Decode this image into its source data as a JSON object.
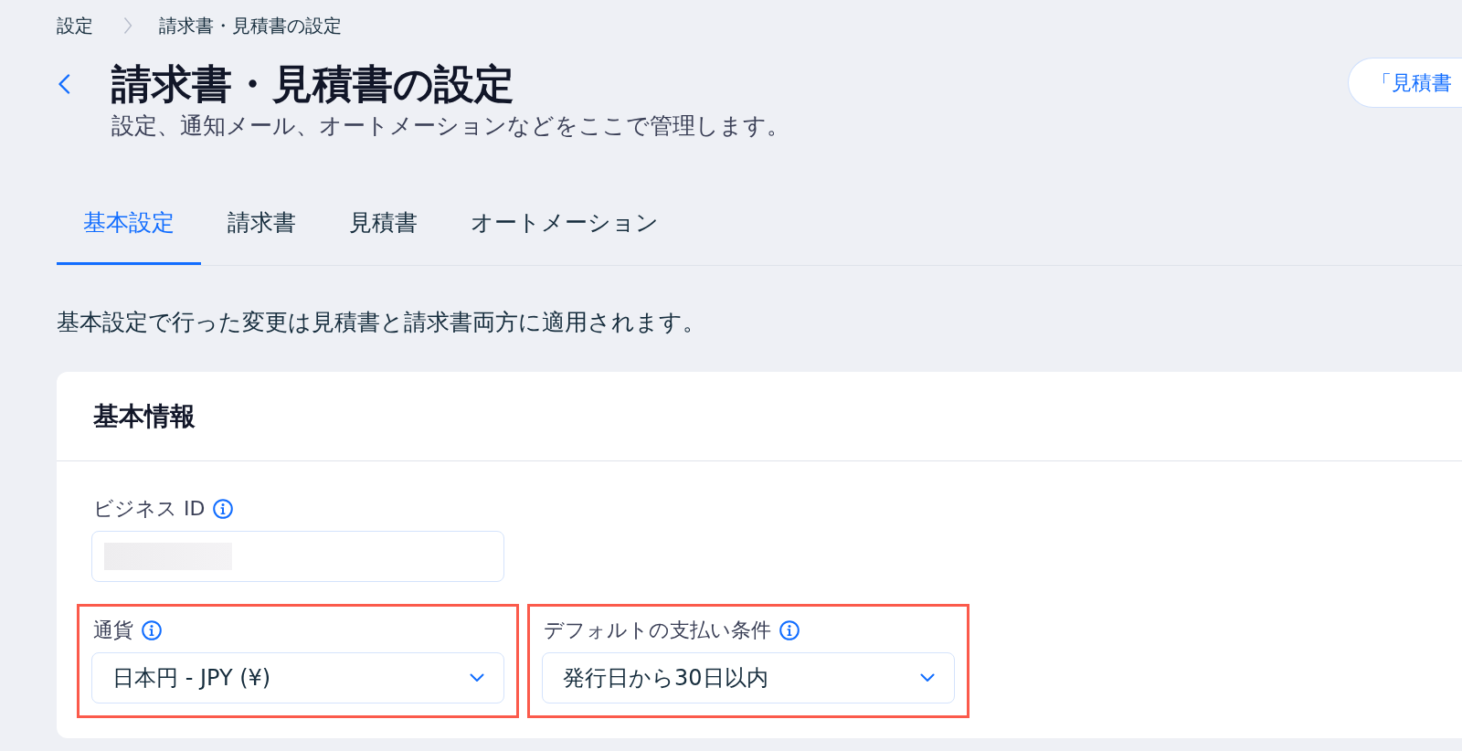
{
  "breadcrumb": [
    {
      "label": "設定"
    },
    {
      "label": "請求書・見積書の設定"
    }
  ],
  "header": {
    "title": "請求書・見積書の設定",
    "subtitle": "設定、通知メール、オートメーションなどをここで管理します。",
    "action_button": "「見積書"
  },
  "tabs": [
    {
      "label": "基本設定",
      "selected": true
    },
    {
      "label": "請求書",
      "selected": false
    },
    {
      "label": "見積書",
      "selected": false
    },
    {
      "label": "オートメーション",
      "selected": false
    }
  ],
  "description": "基本設定で行った変更は見積書と請求書両方に適用されます。",
  "card": {
    "title": "基本情報",
    "rows": [
      [
        {
          "kind": "text",
          "label": "ビジネス ID",
          "value_redacted": true,
          "highlighted": false
        }
      ],
      [
        {
          "kind": "select",
          "label": "通貨",
          "value": "日本円 - JPY (¥)",
          "highlighted": true
        },
        {
          "kind": "select",
          "label": "デフォルトの支払い条件",
          "value": "発行日から30日以内",
          "highlighted": true
        }
      ]
    ]
  }
}
